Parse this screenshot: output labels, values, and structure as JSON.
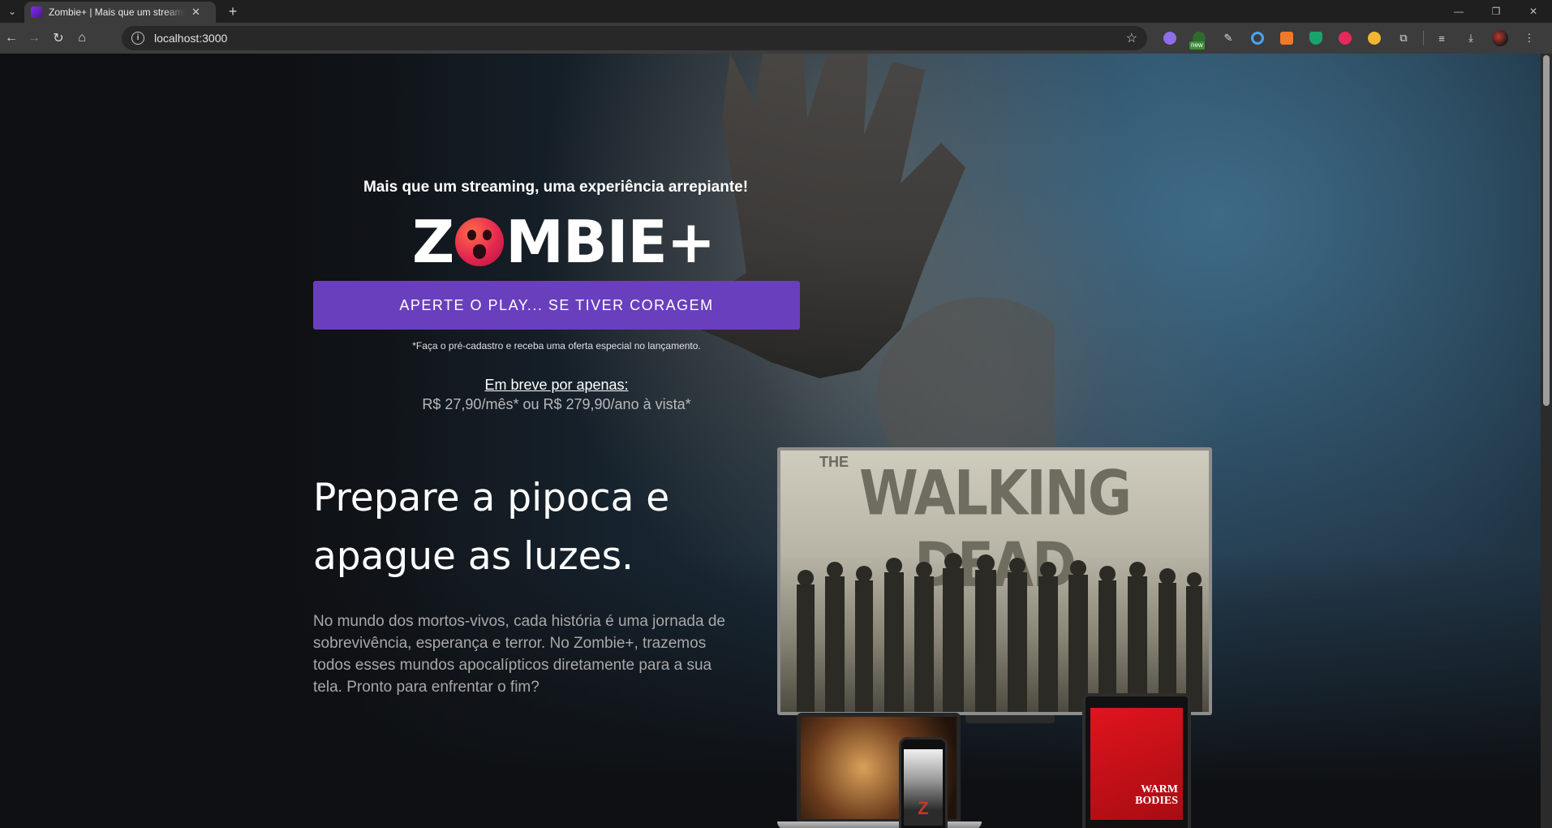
{
  "browser": {
    "tab_title": "Zombie+ | Mais que um streaming, uma experiência arrepiante!",
    "url": "localhost:3000",
    "extensions": [
      {
        "name": "puzzle-color-icon",
        "color": "#8e6ee8"
      },
      {
        "name": "new-badge-ext-icon",
        "color": "#3a8f3a"
      },
      {
        "name": "eyedropper-icon",
        "color": "#e0e0e0"
      },
      {
        "name": "ring-ext-icon",
        "color": "#4aa3f0"
      },
      {
        "name": "orange-ext-icon",
        "color": "#f07a2a"
      },
      {
        "name": "shield-ext-icon",
        "color": "#1aa36b"
      },
      {
        "name": "pink-ext-icon",
        "color": "#e8285c"
      },
      {
        "name": "yellow-ext-icon",
        "color": "#f2b632"
      }
    ],
    "new_badge": "new"
  },
  "hero": {
    "tagline": "Mais que um streaming, uma experiência arrepiante!",
    "logo_left": "Z",
    "logo_right": "MBIE+",
    "cta_label": "APERTE O PLAY... SE TIVER CORAGEM",
    "cta_note": "*Faça o pré-cadastro e receba uma oferta especial no lançamento.",
    "soon_label": "Em breve por apenas:",
    "price": "R$ 27,90/mês* ou R$ 279,90/ano à vista*"
  },
  "section": {
    "headline": "Prepare a pipoca e apague as luzes.",
    "body": "No mundo dos mortos-vivos, cada história é uma jornada de sobrevivência, esperança e terror. No Zombie+, trazemos todos esses mundos apocalípticos diretamente para a sua tela. Pronto para enfrentar o fim?"
  },
  "devices": {
    "tv_prefix": "THE",
    "tv_title": "WALKING DEAD",
    "phone_title": "Z",
    "tablet_title": "WARM BODIES"
  },
  "colors": {
    "cta": "#6a3fbd",
    "logo_o": "#e3284f"
  }
}
